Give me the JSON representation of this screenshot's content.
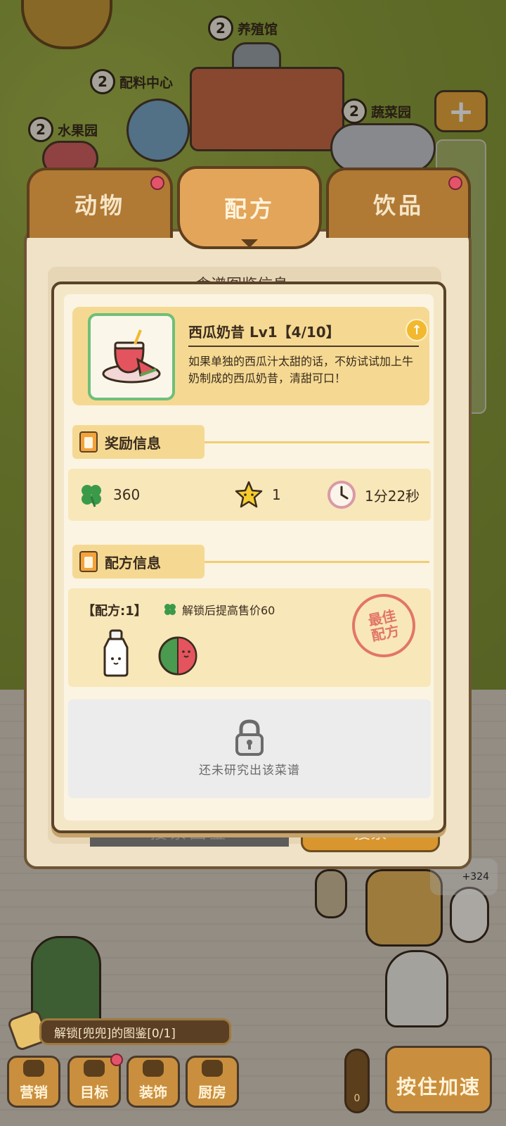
{
  "map": {
    "buildings": [
      {
        "level": "2",
        "name": "养殖馆"
      },
      {
        "level": "2",
        "name": "配料中心"
      },
      {
        "level": "2",
        "name": "蔬菜园"
      },
      {
        "level": "2",
        "name": "水果园"
      }
    ]
  },
  "tabs": [
    {
      "label": "动物",
      "active": false,
      "badge": true
    },
    {
      "label": "配方",
      "active": true,
      "badge": false
    },
    {
      "label": "饮品",
      "active": false,
      "badge": true
    }
  ],
  "back_panel": {
    "title_partial": "食谱图鉴信息",
    "search_placeholder": "搜索图鉴",
    "search_button": "搜索"
  },
  "dialog": {
    "item": {
      "name": "西瓜奶昔 Lv1【4/10】",
      "description": "如果单独的西瓜汁太甜的话，不妨试试加上牛奶制成的西瓜奶昔，清甜可口！"
    },
    "reward_section": {
      "title": "奖励信息",
      "clover": "360",
      "star": "1",
      "time": "1分22秒"
    },
    "recipe_section": {
      "title": "配方信息",
      "count_label": "【配方:1】",
      "bonus_text": "解锁后提高售价60",
      "stamp_line1": "最佳",
      "stamp_line2": "配方",
      "ingredients": [
        "milk-bottle",
        "watermelon"
      ]
    },
    "locked": {
      "text": "还未研究出该菜谱"
    }
  },
  "floating_reward": "+324",
  "task_bar": {
    "text": "解锁[兜兜]的图鉴[0/1]"
  },
  "bottom_nav": [
    {
      "label": "营销",
      "badge": false
    },
    {
      "label": "目标",
      "badge": true
    },
    {
      "label": "装饰",
      "badge": false
    },
    {
      "label": "厨房",
      "badge": false
    }
  ],
  "speed_button": "按住加速",
  "thermometer_value": "0",
  "colors": {
    "tab_inactive": "#b07a35",
    "tab_active": "#e3a55a",
    "card_yellow": "#f5d992",
    "badge_red": "#e3546b",
    "clover_green": "#3a9a4a",
    "stamp_red": "#e06a5e"
  }
}
